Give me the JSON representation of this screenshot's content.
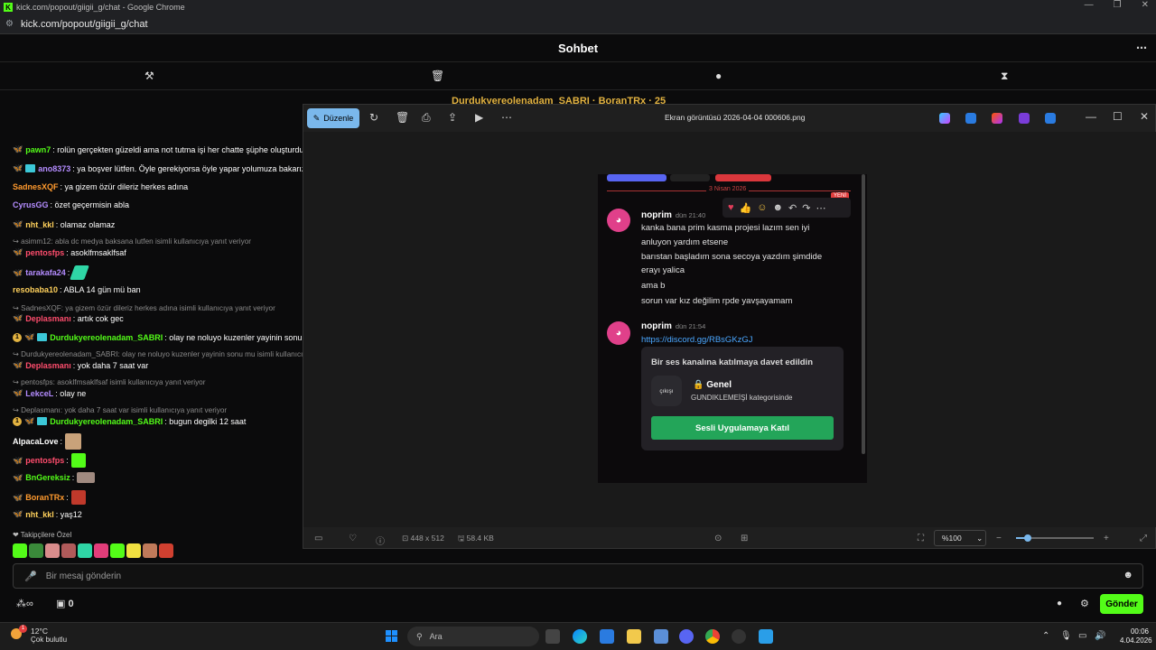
{
  "browser": {
    "title": "kick.com/popout/giigii_g/chat - Google Chrome",
    "url": "kick.com/popout/giigii_g/chat"
  },
  "kick": {
    "header_title": "Sohbet",
    "pinned_text": "Durdukyereolenadam_SABRI · BoranTRx · 25",
    "messages": [
      {
        "user": "pawn7",
        "text": ": rolün gerçekten güzeldi ama not tutma işi her chatte şüphe oluşturdu",
        "color": "#53fc18"
      },
      {
        "user": "ano8373",
        "text": ": ya boşver lütfen. Öyle gerekiyorsa öyle yapar yolumuza bakarız",
        "color": "#b48cff"
      },
      {
        "user": "SadnesXQF",
        "text": ": ya gizem özür dileriz herkes adına",
        "color": "#ff9a2e"
      },
      {
        "user": "CyrusGG",
        "text": ": özet geçermisin abla",
        "color": "#b48cff"
      },
      {
        "user": "nht_kkl",
        "text": ": olamaz olamaz",
        "color": "#ffd15c"
      },
      {
        "reply": "asimm12: abla dc medya baksana lutfen isimli kullanıcıya yanıt veriyor"
      },
      {
        "user": "pentosfps",
        "text": ": asoklfmsaklfsaf",
        "color": "#ff4d6d"
      },
      {
        "user": "tarakafa24",
        "text": ":",
        "color": "#b48cff"
      },
      {
        "user": "resobaba10",
        "text": ": ABLA 14 gün mü ban",
        "color": "#ffd15c"
      },
      {
        "reply": "SadnesXQF: ya gizem özür dileriz herkes adına isimli kullanıcıya yanıt veriyor"
      },
      {
        "user": "Deplasmanı",
        "text": ": artık cok gec",
        "color": "#ff4d6d"
      },
      {
        "user": "Durdukyereolenadam_SABRI",
        "text": ": olay ne noluyo kuzenler yayinin sonu",
        "color": "#53fc18"
      },
      {
        "reply": "Durdukyereolenadam_SABRI: olay ne noluyo kuzenler yayinin sonu mu isimli kullanıcıya yanıt veriyor"
      },
      {
        "user": "Deplasmanı",
        "text": ": yok daha 7 saat var",
        "color": "#ff4d6d"
      },
      {
        "reply": "pentosfps: asoklfmsaklfsaf isimli kullanıcıya yanıt veriyor"
      },
      {
        "user": "LekceL",
        "text": ": olay ne",
        "color": "#b48cff"
      },
      {
        "reply": "Deplasmanı: yok daha 7 saat var isimli kullanıcıya yanıt veriyor"
      },
      {
        "user": "Durdukyereolenadam_SABRI",
        "text": ": bugun degilki 12 saat",
        "color": "#53fc18"
      },
      {
        "user": "AlpacaLove",
        "text": ":",
        "color": "#ffffff"
      },
      {
        "user": "pentosfps",
        "text": ":",
        "color": "#ff4d6d"
      },
      {
        "user": "BnGereksiz",
        "text": ":",
        "color": "#53fc18"
      },
      {
        "user": "BoranTRx",
        "text": ":",
        "color": "#ff9a2e"
      },
      {
        "user": "nht_kkl",
        "text": ": yaş12",
        "color": "#ffd15c"
      }
    ],
    "follower_label": "Takipçilere Özel",
    "input_placeholder": "Bir mesaj gönderin",
    "gift_count": "0",
    "send_label": "Gönder"
  },
  "photos": {
    "edit_label": "Düzenle",
    "file_title": "Ekran görüntüsü 2026-04-04 000606.png",
    "dimensions": "448 x 512",
    "file_size": "58.4 KB",
    "zoom": "%100",
    "zoom_level_percent": 15
  },
  "discord": {
    "date_sep": "3 Nisan 2026",
    "new_badge": "YENİ",
    "msg1": {
      "user": "noprim",
      "time": "dün 21:40",
      "lines": [
        "kanka bana prim kasma projesi lazım sen iyi",
        "anluyon yardım etsene",
        "barıstan başladım sona secoya yazdım  şimdide",
        "erayı yalica",
        "ama b",
        "sorun  var kız değilim rpde yavşayamam"
      ]
    },
    "msg2": {
      "user": "noprim",
      "time": "dün 21:54",
      "link": "https://discord.gg/RBsGKzGJ"
    },
    "invite": {
      "heading": "Bir ses kanalına katılmaya davet edildin",
      "server_icon_text": "çıkışı",
      "channel": "Genel",
      "category": "GUNDIKLEMEİŞİ kategorisinde",
      "join_label": "Sesli Uygulamaya Katıl"
    }
  },
  "taskbar": {
    "temp": "12°C",
    "weather": "Çok bulutlu",
    "search_placeholder": "Ara",
    "time": "00:06",
    "date": "4.04.2026"
  }
}
